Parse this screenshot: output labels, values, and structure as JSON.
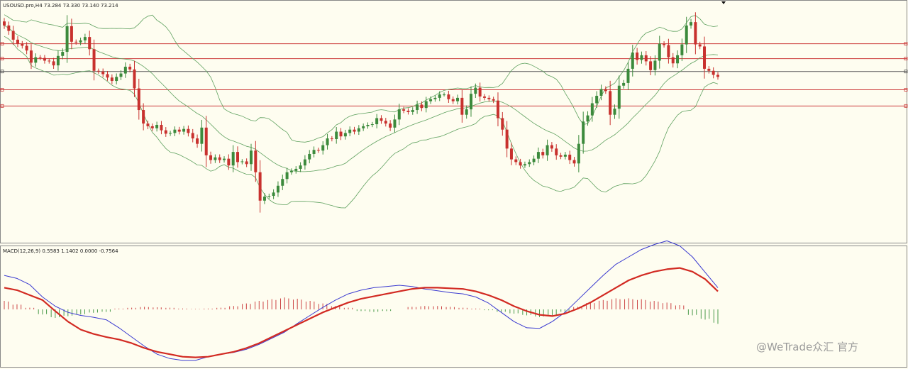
{
  "window": {
    "symbol_header": "USOUSD.pro,H4  73.284 73.330 73.140 73.214",
    "indicator_header": "MACD(12,26,9) 0.5583 1.1402 0.0000 -0.7564",
    "watermark": "@WeTrade众汇 官方"
  },
  "colors": {
    "background": "#fefdf0",
    "bull_candle": "#3c8a3c",
    "bear_candle": "#c8312e",
    "bollinger": "#5fa15f",
    "level_line": "#cc3b3b",
    "current_level": "#555555",
    "macd_signal": "#d22a22",
    "macd_main": "#3a3ad0",
    "hist_positive": "#cc4444",
    "hist_negative": "#4a9a4a"
  },
  "chart_data": [
    {
      "type": "candlestick",
      "title": "USOUSD.pro,H4",
      "ohlc_last": {
        "open": 73.284,
        "high": 73.33,
        "low": 73.14,
        "close": 73.214
      },
      "horizontal_levels": [
        {
          "price": 73.7,
          "kind": "resistance"
        },
        {
          "price": 73.48,
          "kind": "resistance"
        },
        {
          "price": 73.29,
          "kind": "current"
        },
        {
          "price": 73.02,
          "kind": "support"
        },
        {
          "price": 72.78,
          "kind": "support"
        }
      ],
      "ylim": [
        70.8,
        74.2
      ],
      "close_series": [
        73.97,
        73.89,
        73.76,
        73.7,
        73.67,
        73.6,
        73.42,
        73.5,
        73.49,
        73.45,
        73.44,
        73.38,
        73.52,
        73.58,
        73.96,
        73.73,
        73.72,
        73.75,
        73.8,
        73.62,
        73.3,
        73.29,
        73.25,
        73.2,
        73.15,
        73.21,
        73.26,
        73.36,
        73.32,
        73.04,
        72.72,
        72.52,
        72.48,
        72.45,
        72.5,
        72.42,
        72.37,
        72.38,
        72.43,
        72.4,
        72.44,
        72.38,
        72.3,
        72.22,
        72.46,
        72.05,
        71.98,
        72.02,
        71.98,
        72.0,
        71.9,
        72.1,
        71.95,
        71.96,
        71.92,
        72.12,
        71.8,
        71.38,
        71.44,
        71.45,
        71.5,
        71.6,
        71.7,
        71.8,
        71.82,
        71.85,
        71.9,
        71.99,
        72.07,
        72.13,
        72.12,
        72.2,
        72.3,
        72.29,
        72.4,
        72.33,
        72.38,
        72.43,
        72.4,
        72.45,
        72.48,
        72.5,
        72.51,
        72.6,
        72.56,
        72.52,
        72.46,
        72.58,
        72.73,
        72.71,
        72.69,
        72.72,
        72.8,
        72.75,
        72.85,
        72.88,
        72.9,
        72.95,
        72.95,
        72.88,
        72.85,
        72.9,
        72.65,
        72.73,
        72.96,
        73.05,
        72.92,
        72.9,
        72.88,
        72.86,
        72.6,
        72.43,
        72.15,
        71.99,
        71.95,
        71.9,
        71.92,
        71.95,
        72.0,
        72.1,
        72.05,
        72.2,
        72.15,
        72.05,
        72.03,
        72.06,
        71.98,
        71.93,
        72.22,
        72.55,
        72.64,
        72.82,
        72.93,
        73.03,
        73.0,
        72.65,
        72.74,
        73.08,
        73.12,
        73.33,
        73.57,
        73.46,
        73.53,
        73.44,
        73.31,
        73.45,
        73.7,
        73.68,
        73.5,
        73.41,
        73.53,
        73.69,
        73.97,
        74.02,
        73.69,
        73.66,
        73.33,
        73.3,
        73.24,
        73.21
      ]
    },
    {
      "type": "line",
      "title": "MACD(12,26,9)",
      "values_printed": [
        0.5583,
        1.1402,
        0.0,
        -0.7564
      ],
      "series": [
        {
          "values": [
            0.1,
            0.06,
            -0.02,
            -0.1,
            -0.28,
            -0.45,
            -0.58,
            -0.65,
            -0.7,
            -0.74,
            -0.8,
            -0.88,
            -0.94,
            -0.98,
            -1.02,
            -1.03,
            -1.02,
            -0.98,
            -0.94,
            -0.88,
            -0.8,
            -0.7,
            -0.6,
            -0.5,
            -0.4,
            -0.3,
            -0.22,
            -0.14,
            -0.08,
            -0.04,
            0.0,
            0.04,
            0.08,
            0.1,
            0.1,
            0.09,
            0.08,
            0.04,
            -0.02,
            -0.1,
            -0.2,
            -0.28,
            -0.34,
            -0.36,
            -0.32,
            -0.24,
            -0.14,
            -0.02,
            0.1,
            0.22,
            0.3,
            0.36,
            0.4,
            0.42,
            0.36,
            0.24,
            0.04
          ]
        },
        {
          "values": [
            0.3,
            0.25,
            0.15,
            -0.05,
            -0.2,
            -0.3,
            -0.35,
            -0.38,
            -0.42,
            -0.55,
            -0.7,
            -0.85,
            -0.98,
            -1.05,
            -1.08,
            -1.08,
            -1.02,
            -0.98,
            -0.95,
            -0.9,
            -0.82,
            -0.72,
            -0.62,
            -0.48,
            -0.35,
            -0.22,
            -0.1,
            0.0,
            0.06,
            0.1,
            0.12,
            0.14,
            0.12,
            0.08,
            0.05,
            0.02,
            0.0,
            -0.05,
            -0.15,
            -0.3,
            -0.45,
            -0.55,
            -0.56,
            -0.45,
            -0.3,
            -0.1,
            0.1,
            0.3,
            0.48,
            0.6,
            0.72,
            0.8,
            0.86,
            0.78,
            0.6,
            0.35,
            0.1
          ]
        }
      ],
      "histogram": [
        0.2,
        0.12,
        0.04,
        -0.12,
        -0.2,
        -0.16,
        -0.12,
        -0.08,
        -0.06,
        0.02,
        0.04,
        0.06,
        0.05,
        0.04,
        0.02,
        0.01,
        0.02,
        0.04,
        0.08,
        0.14,
        0.2,
        0.24,
        0.28,
        0.25,
        0.2,
        0.14,
        0.08,
        0.04,
        -0.04,
        -0.06,
        -0.04,
        0.0,
        0.06,
        0.08,
        0.08,
        0.06,
        0.04,
        0.02,
        -0.02,
        -0.06,
        -0.1,
        -0.14,
        -0.18,
        -0.14,
        -0.06,
        0.06,
        0.16,
        0.22,
        0.26,
        0.26,
        0.24,
        0.2,
        0.16,
        0.1,
        -0.14,
        -0.24,
        -0.34
      ]
    }
  ]
}
